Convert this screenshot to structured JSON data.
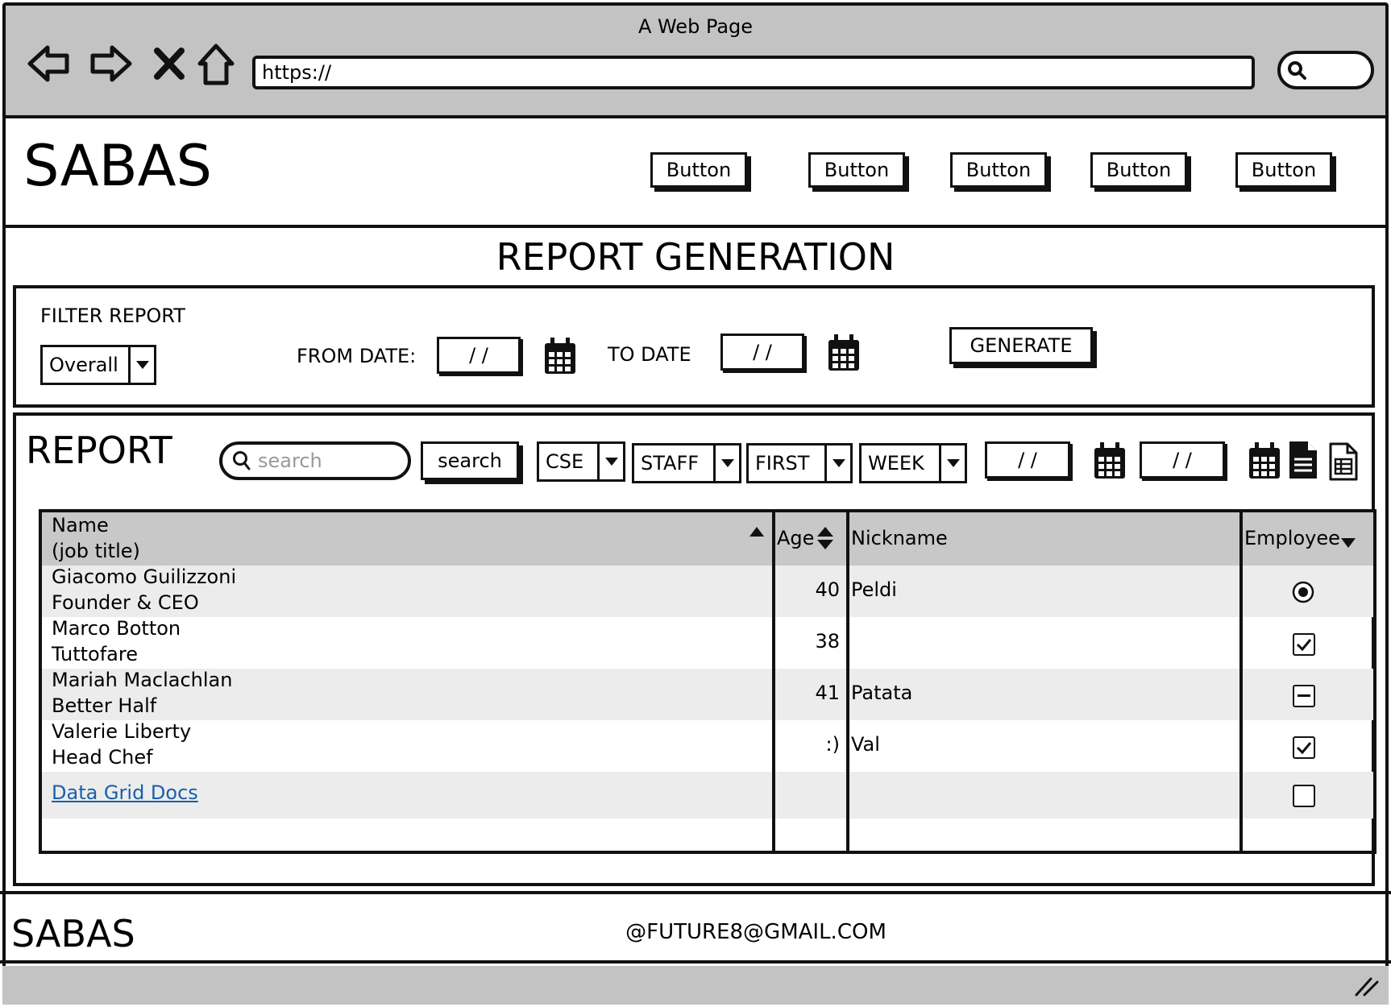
{
  "window": {
    "title": "A Web Page",
    "url": "https://"
  },
  "header": {
    "logo": "SABAS",
    "buttons": [
      "Button",
      "Button",
      "Button",
      "Button",
      "Button"
    ]
  },
  "page_title": "REPORT GENERATION",
  "filter": {
    "label": "FILTER REPORT",
    "select_value": "Overall",
    "from_label": "FROM DATE:",
    "from_value": "/ /",
    "to_label": "TO DATE",
    "to_value": "/ /",
    "generate_label": "GENERATE"
  },
  "report": {
    "title": "REPORT",
    "search_placeholder": "search",
    "search_button": "search",
    "dropdowns": [
      "CSE",
      "STAFF",
      "FIRST",
      "WEEK"
    ],
    "date1": "/ /",
    "date2": "/ /"
  },
  "grid": {
    "headers": {
      "name": "Name",
      "name_sub": "(job title)",
      "age": "Age",
      "nickname": "Nickname",
      "employee": "Employee"
    },
    "rows": [
      {
        "name": "Giacomo Guilizzoni",
        "title": "Founder & CEO",
        "age": "40",
        "nickname": "Peldi",
        "employee": "radio-selected"
      },
      {
        "name": "Marco Botton",
        "title": "Tuttofare",
        "age": "38",
        "nickname": "",
        "employee": "checked"
      },
      {
        "name": "Mariah Maclachlan",
        "title": "Better Half",
        "age": "41",
        "nickname": "Patata",
        "employee": "indeterminate"
      },
      {
        "name": "Valerie Liberty",
        "title": "Head Chef",
        "age": ":)",
        "nickname": "Val",
        "employee": "checked"
      }
    ],
    "link_text": "Data Grid Docs",
    "link_row_employee": "unchecked"
  },
  "footer": {
    "logo": "SABAS",
    "email": "@FUTURE8@GMAIL.COM"
  },
  "colors": {
    "chrome_gray": "#c3c3c3",
    "header_gray": "#c8c8c8",
    "row_alt": "#ececec",
    "link": "#1a5ea8"
  }
}
